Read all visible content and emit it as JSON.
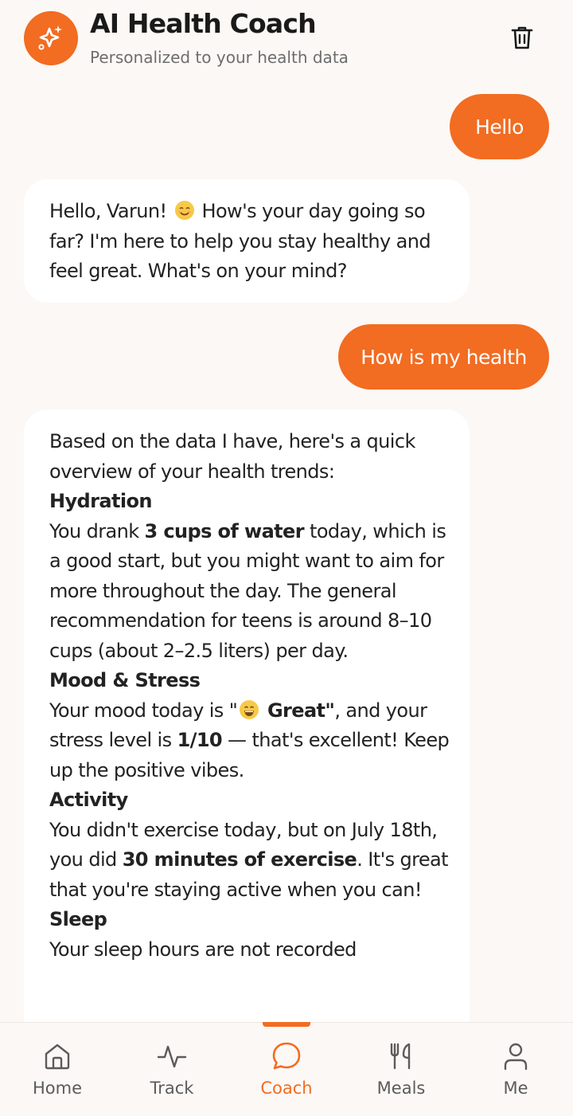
{
  "header": {
    "title": "AI Health Coach",
    "subtitle": "Personalized to your health data",
    "logo_icon": "sparkles-icon",
    "trash_icon": "trash-icon"
  },
  "colors": {
    "accent": "#f26c21",
    "background": "#fcf8f5",
    "ai_bubble": "#ffffff"
  },
  "messages": [
    {
      "role": "user",
      "text": "Hello"
    },
    {
      "role": "assistant",
      "intro": "Hello, Varun! ",
      "rest": " How's your day going so far? I'm here to help you stay healthy and feel great. What's on your mind?"
    },
    {
      "role": "user",
      "text": "How is my health"
    },
    {
      "role": "assistant",
      "intro": "Based on the data I have, here's a quick overview of your health trends:",
      "hydration": {
        "heading": "Hydration",
        "pre": "You drank ",
        "bold": "3 cups of water",
        "post": " today, which is a good start, but you might want to aim for more throughout the day. The general recommendation for teens is around 8–10 cups (about 2–2.5 liters) per day."
      },
      "mood": {
        "heading": "Mood & Stress",
        "pre": "Your mood today is \"",
        "bold_mood": " Great\"",
        "mid": ", and your stress level is ",
        "bold_stress": "1/10",
        "post": " — that's excellent! Keep up the positive vibes."
      },
      "activity": {
        "heading": "Activity",
        "pre": "You didn't exercise today, but on July 18th, you did ",
        "bold": "30 minutes of exercise",
        "post": ". It's great that you're staying active when you can!"
      },
      "sleep": {
        "heading": "Sleep",
        "text": "Your sleep hours are not recorded"
      }
    }
  ],
  "nav": {
    "items": [
      {
        "label": "Home",
        "icon": "home-icon"
      },
      {
        "label": "Track",
        "icon": "activity-icon"
      },
      {
        "label": "Coach",
        "icon": "chat-bubble-icon"
      },
      {
        "label": "Meals",
        "icon": "utensils-icon"
      },
      {
        "label": "Me",
        "icon": "user-icon"
      }
    ],
    "active": "Coach"
  }
}
